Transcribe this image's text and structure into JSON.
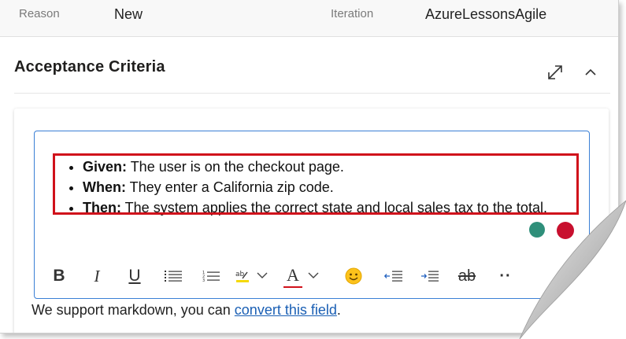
{
  "fields": {
    "reason_label": "Reason",
    "reason_value": "New",
    "iteration_label": "Iteration",
    "iteration_value": "AzureLessonsAgile"
  },
  "section": {
    "title": "Acceptance Criteria",
    "expand_icon": "expand-diagonal-icon",
    "collapse_icon": "chevron-up-icon"
  },
  "criteria": [
    {
      "keyword": "Given:",
      "text": " The user is on the checkout page."
    },
    {
      "keyword": "When:",
      "text": " They enter a California zip code."
    },
    {
      "keyword": "Then:",
      "text": " The system applies the correct state and local sales tax to the total."
    }
  ],
  "toolbar": {
    "bold": "B",
    "italic": "I",
    "underline": "U",
    "font_color": "A",
    "strikethrough": "ab",
    "more": "··"
  },
  "footer": {
    "text": "We support markdown, you can ",
    "link": "convert this field",
    "end": "."
  },
  "colors": {
    "accent_border": "#3a7fd5",
    "highlight_box": "#d0111b",
    "link": "#1a5fb4"
  }
}
